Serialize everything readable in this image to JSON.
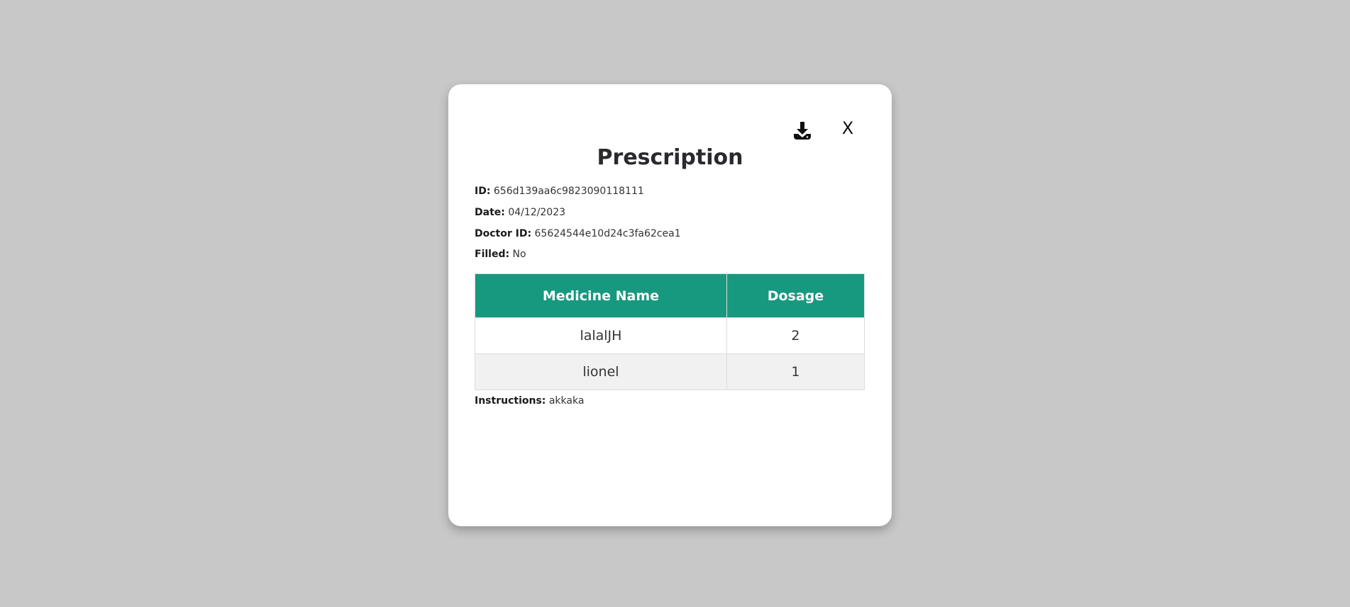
{
  "modal": {
    "title": "Prescription",
    "close_label": "X",
    "download_icon": "download-icon"
  },
  "details": {
    "id_label": "ID:",
    "id_value": "656d139aa6c9823090118111",
    "date_label": "Date:",
    "date_value": "04/12/2023",
    "doctor_label": "Doctor ID:",
    "doctor_value": "65624544e10d24c3fa62cea1",
    "filled_label": "Filled:",
    "filled_value": "No"
  },
  "table": {
    "headers": [
      "Medicine Name",
      "Dosage"
    ],
    "rows": [
      {
        "name": "lalalJH",
        "dosage": "2"
      },
      {
        "name": "lionel",
        "dosage": "1"
      }
    ],
    "header_color": "#16997f"
  },
  "instructions": {
    "label": "Instructions:",
    "value": "akkaka"
  }
}
